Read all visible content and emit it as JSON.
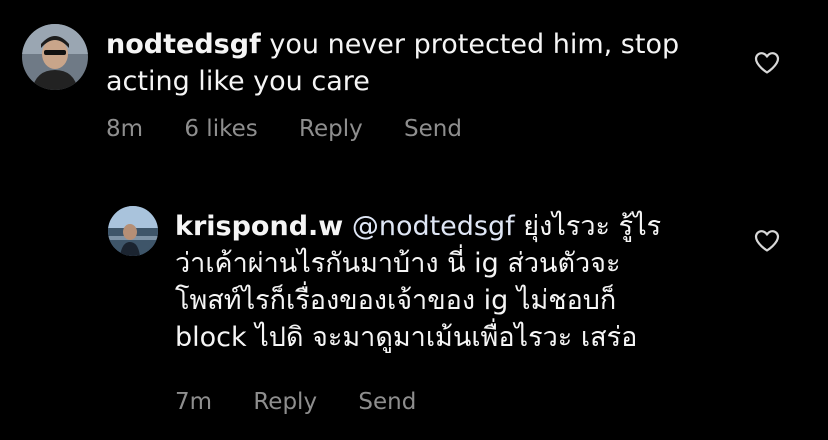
{
  "comments": [
    {
      "username": "nodtedsgf",
      "text": "you never protected him, stop acting like you care",
      "time": "8m",
      "likes": "6 likes",
      "reply_label": "Reply",
      "send_label": "Send"
    },
    {
      "username": "krispond.w",
      "mention": "@nodtedsgf",
      "line1": "ยุ่งไรวะ รู้ไร",
      "line2": "ว่าเค้าผ่านไรกันมาบ้าง นี่ ig ส่วนตัวจะ",
      "line3": "โพสท์ไรก็เรื่องของเจ้าของ ig ไม่ชอบก็",
      "line4": "block ไปดิ จะมาดูมาเม้นเพื่อไรวะ เสร่อ",
      "time": "7m",
      "reply_label": "Reply",
      "send_label": "Send"
    }
  ],
  "icons": {
    "like": "heart-outline-icon"
  },
  "colors": {
    "background": "#000000",
    "text": "#f5f5f5",
    "meta": "#8e8e8e"
  }
}
